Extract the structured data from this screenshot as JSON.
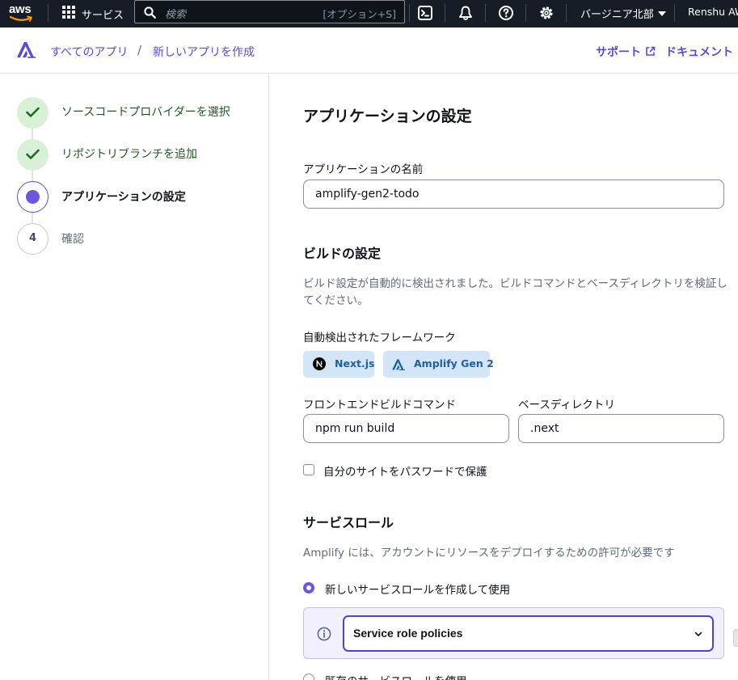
{
  "topnav": {
    "logo_text": "aws",
    "services_label": "サービス",
    "search_placeholder": "検索",
    "search_shortcut": "[オプション+S]",
    "icons": [
      "cloudshell-icon",
      "notifications-icon",
      "help-icon",
      "settings-icon"
    ],
    "region": "バージニア北部",
    "account": "Renshu AW"
  },
  "breadcrumb": {
    "items": [
      "すべてのアプリ",
      "新しいアプリを作成"
    ],
    "separator": "/"
  },
  "header_links": {
    "support": "サポート",
    "docs": "ドキュメント"
  },
  "steps": [
    {
      "label": "ソースコードプロバイダーを選択",
      "state": "done"
    },
    {
      "label": "リポジトリブランチを追加",
      "state": "done"
    },
    {
      "label": "アプリケーションの設定",
      "state": "current"
    },
    {
      "label": "確認",
      "state": "todo",
      "number": "4"
    }
  ],
  "main": {
    "title": "アプリケーションの設定",
    "app_name_label": "アプリケーションの名前",
    "app_name_value": "amplify-gen2-todo",
    "build": {
      "heading": "ビルドの設定",
      "description": "ビルド設定が自動的に検出されました。ビルドコマンドとベースディレクトリを検証してください。",
      "frameworks_label": "自動検出されたフレームワーク",
      "frameworks": [
        "Next.js",
        "Amplify Gen 2"
      ],
      "build_command_label": "フロントエンドビルドコマンド",
      "build_command_value": "npm run build",
      "base_dir_label": "ベースディレクトリ",
      "base_dir_value": ".next",
      "password_checkbox_label": "自分のサイトをパスワードで保護",
      "password_checked": false
    },
    "service_role": {
      "heading": "サービスロール",
      "description": "Amplify には、アカウントにリソースをデプロイするための許可が必要です",
      "option_new": "新しいサービスロールを作成して使用",
      "option_existing": "既存のサービスロールを使用",
      "selected": "new",
      "policies_label": "Service role policies"
    }
  },
  "colors": {
    "nav_bg": "#161d26",
    "accent": "#5b4ad6",
    "success_bg": "#d8f0d5",
    "success_text": "#1d5b1d",
    "chip_bg": "#d3e6f7",
    "policy_bg": "#f2efff"
  }
}
